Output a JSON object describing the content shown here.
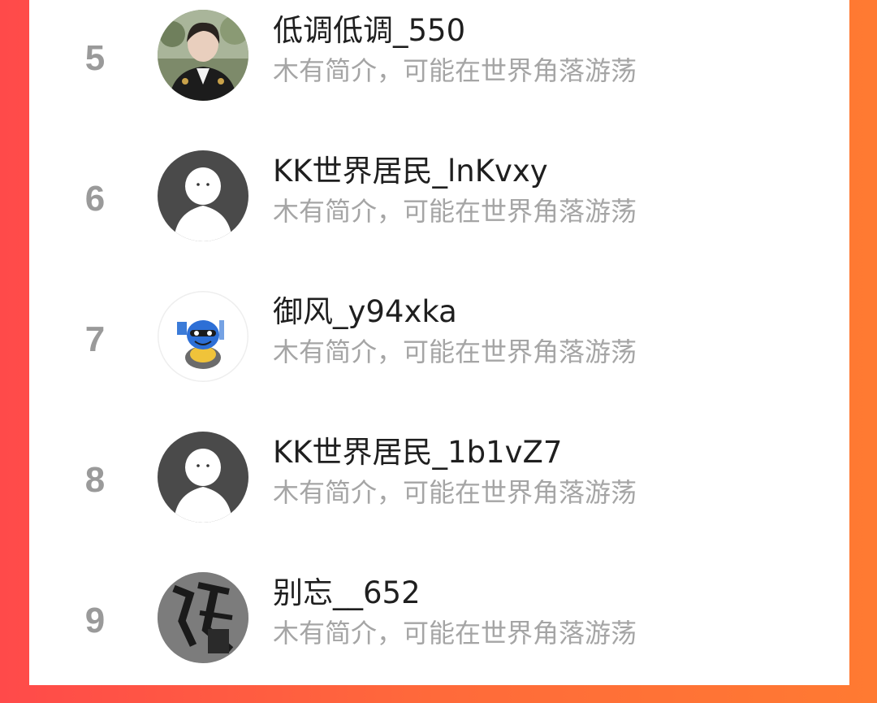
{
  "list": {
    "items": [
      {
        "rank": "5",
        "name": "低调低调_550",
        "desc": "木有简介，可能在世界角落游荡",
        "avatar": "user-photo"
      },
      {
        "rank": "6",
        "name": "KK世界居民_lnKvxy",
        "desc": "木有简介，可能在世界角落游荡",
        "avatar": "default-avatar"
      },
      {
        "rank": "7",
        "name": "御风_y94xka",
        "desc": "木有简介，可能在世界角落游荡",
        "avatar": "cartoon-character"
      },
      {
        "rank": "8",
        "name": "KK世界居民_1b1vZ7",
        "desc": "木有简介，可能在世界角落游荡",
        "avatar": "default-avatar"
      },
      {
        "rank": "9",
        "name": "别忘__652",
        "desc": "木有简介，可能在世界角落游荡",
        "avatar": "calligraphy-image"
      }
    ]
  },
  "colors": {
    "background_left": "#ff4a4a",
    "background_right": "#ff7a32",
    "card": "#ffffff",
    "rank": "#9a9a9a",
    "name": "#1f1f1f",
    "desc": "#a5a5a5",
    "default_avatar": "#4a4a4a"
  }
}
